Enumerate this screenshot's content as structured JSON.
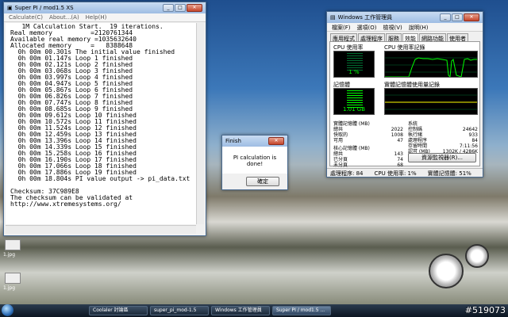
{
  "superpi": {
    "title": "Super PI / mod1.5 XS",
    "menu": [
      "Calculate(C)",
      "About...(A)",
      "Help(H)"
    ],
    "lines": [
      "   1M Calculation Start.  19 iterations.",
      "Real memory          =2120761344",
      "Available real memory =1035632640",
      "Allocated memory     =   8388648",
      "  0h 00m 00.301s The initial value finished",
      "  0h 00m 01.147s Loop 1 finished",
      "  0h 00m 02.121s Loop 2 finished",
      "  0h 00m 03.068s Loop 3 finished",
      "  0h 00m 03.997s Loop 4 finished",
      "  0h 00m 04.947s Loop 5 finished",
      "  0h 00m 05.867s Loop 6 finished",
      "  0h 00m 06.826s Loop 7 finished",
      "  0h 00m 07.747s Loop 8 finished",
      "  0h 00m 08.685s Loop 9 finished",
      "  0h 00m 09.612s Loop 10 finished",
      "  0h 00m 10.572s Loop 11 finished",
      "  0h 00m 11.524s Loop 12 finished",
      "  0h 00m 12.459s Loop 13 finished",
      "  0h 00m 13.396s Loop 14 finished",
      "  0h 00m 14.339s Loop 15 finished",
      "  0h 00m 15.258s Loop 16 finished",
      "  0h 00m 16.190s Loop 17 finished",
      "  0h 00m 17.066s Loop 18 finished",
      "  0h 00m 17.886s Loop 19 finished",
      "  0h 00m 18.804s PI value output -> pi_data.txt",
      "",
      "Checksum: 37C989E8",
      "The checksum can be validated at",
      "http://www.xtremesystems.org/"
    ]
  },
  "dialog": {
    "title": "Finish",
    "message": "PI calculation is done!",
    "ok_label": "確定"
  },
  "taskmgr": {
    "title": "Windows 工作管理員",
    "menu": [
      "檔案(F)",
      "選項(O)",
      "檢視(V)",
      "說明(H)"
    ],
    "tabs": [
      "應用程式",
      "處理程序",
      "服務",
      "效能",
      "網路功能",
      "使用者"
    ],
    "active_tab": "效能",
    "cpu_usage_label": "CPU 使用率",
    "cpu_usage_value": "1 %",
    "cpu_history_label": "CPU 使用率記錄",
    "memory_label": "記憶體",
    "memory_value": "1.01 GB",
    "memory_history_label": "實體記憶體使用量記錄",
    "physical_title": "實體記憶體 (MB)",
    "physical": [
      {
        "k": "總共",
        "v": "2022"
      },
      {
        "k": "快取的",
        "v": "1008"
      },
      {
        "k": "可用",
        "v": "47"
      }
    ],
    "kernel_title": "核心記憶體 (MB)",
    "kernel": [
      {
        "k": "總共",
        "v": "143"
      },
      {
        "k": "已分頁",
        "v": "74"
      },
      {
        "k": "未分頁",
        "v": "68"
      }
    ],
    "system_title": "系統",
    "system": [
      {
        "k": "控制碼",
        "v": "24642"
      },
      {
        "k": "執行緒",
        "v": "933"
      },
      {
        "k": "處理程序",
        "v": "84"
      },
      {
        "k": "存留時間",
        "v": "7:11:56"
      },
      {
        "k": "認可 (MB)",
        "v": "1302K / 4286K"
      }
    ],
    "resource_button": "資源監視器(R)...",
    "status": {
      "processes": "處理程序: 84",
      "cpu": "CPU 使用率: 1%",
      "memory": "實體記憶體: 51%"
    }
  },
  "desktop": {
    "icons": [
      {
        "label": "1.jpg"
      },
      {
        "label": "1.jpg"
      }
    ]
  },
  "taskbar": {
    "items": [
      "Coolaler 討論區",
      "super_pi_mod-1.5",
      "Windows 工作管理員",
      "Super PI / mod1.5 ..."
    ],
    "active_index": 3
  },
  "watermark": "#519073",
  "colors": {
    "graph_line": "#00ff00",
    "graph_grid": "#006c30"
  }
}
